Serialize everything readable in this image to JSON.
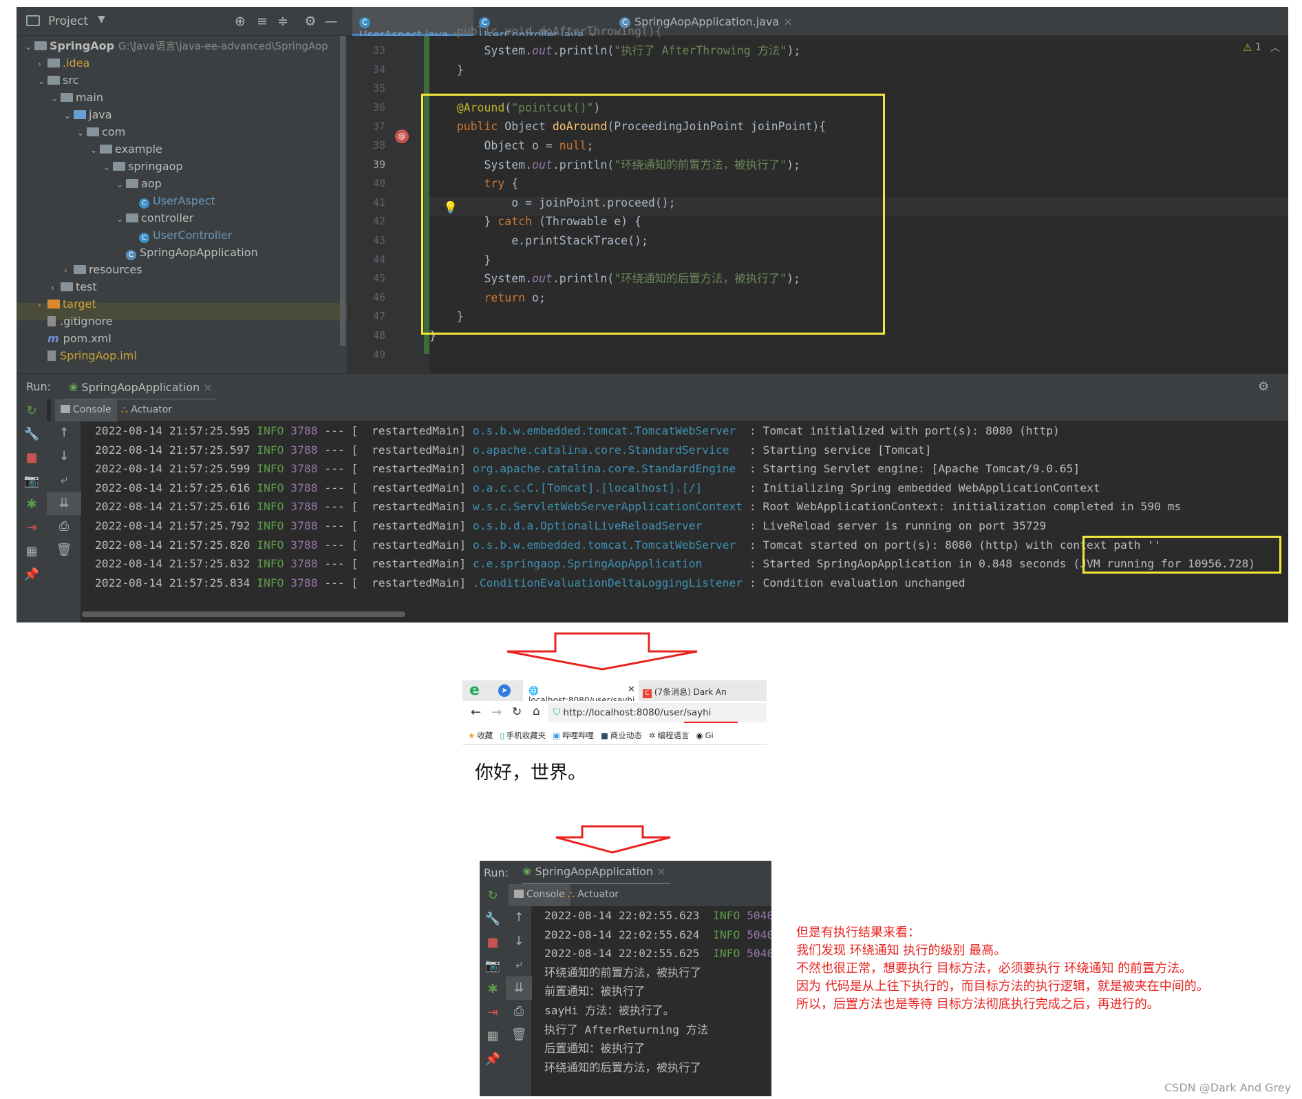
{
  "ide": {
    "project_label": "Project",
    "tabs": [
      {
        "label": "UserAspect.java",
        "active": true
      },
      {
        "label": "UserController.java",
        "active": false
      },
      {
        "label": "SpringAopApplication.java",
        "active": false
      }
    ],
    "warnings_count": "1",
    "tree": [
      {
        "label": "SpringAop",
        "extra": "G:\\Java语言\\java-ee-advanced\\SpringAop",
        "depth": 0,
        "type": "module",
        "open": true
      },
      {
        "label": ".idea",
        "depth": 1,
        "type": "folder",
        "open": false,
        "color": "#c9a338"
      },
      {
        "label": "src",
        "depth": 1,
        "type": "folder",
        "open": true
      },
      {
        "label": "main",
        "depth": 2,
        "type": "folder",
        "open": true
      },
      {
        "label": "java",
        "depth": 3,
        "type": "folder-blue",
        "open": true
      },
      {
        "label": "com",
        "depth": 4,
        "type": "folder",
        "open": true
      },
      {
        "label": "example",
        "depth": 5,
        "type": "folder",
        "open": true
      },
      {
        "label": "springaop",
        "depth": 6,
        "type": "folder",
        "open": true
      },
      {
        "label": "aop",
        "depth": 7,
        "type": "folder",
        "open": true
      },
      {
        "label": "UserAspect",
        "depth": 8,
        "type": "class",
        "color": "#6897bb"
      },
      {
        "label": "controller",
        "depth": 7,
        "type": "folder",
        "open": true
      },
      {
        "label": "UserController",
        "depth": 8,
        "type": "class",
        "color": "#6897bb"
      },
      {
        "label": "SpringAopApplication",
        "depth": 7,
        "type": "app"
      },
      {
        "label": "resources",
        "depth": 3,
        "type": "folder",
        "open": false
      },
      {
        "label": "test",
        "depth": 2,
        "type": "folder",
        "open": false
      },
      {
        "label": "target",
        "depth": 1,
        "type": "folder-orange",
        "open": false,
        "color": "#c9a338"
      },
      {
        "label": ".gitignore",
        "depth": 1,
        "type": "file"
      },
      {
        "label": "pom.xml",
        "depth": 1,
        "type": "maven"
      },
      {
        "label": "SpringAop.iml",
        "depth": 1,
        "type": "file",
        "color": "#c9a338"
      }
    ],
    "line_numbers": [
      "33",
      "34",
      "35",
      "36",
      "37",
      "38",
      "39",
      "40",
      "41",
      "42",
      "43",
      "44",
      "45",
      "46",
      "47",
      "48",
      "49"
    ],
    "code_top_partial": "    public void doAfterThrowing(){",
    "code": [
      [
        {
          "t": "        System."
        },
        {
          "t": "out",
          "c": "fld"
        },
        {
          "t": ".println("
        },
        {
          "t": "\"执行了 AfterThrowing 方法\"",
          "c": "str"
        },
        {
          "t": ");"
        }
      ],
      [
        {
          "t": "    }"
        }
      ],
      [
        {
          "t": ""
        }
      ],
      [
        {
          "t": "    "
        },
        {
          "t": "@Around",
          "c": "ann"
        },
        {
          "t": "("
        },
        {
          "t": "\"pointcut()\"",
          "c": "str"
        },
        {
          "t": ")"
        }
      ],
      [
        {
          "t": "    "
        },
        {
          "t": "public ",
          "c": "kw"
        },
        {
          "t": "Object "
        },
        {
          "t": "doAround",
          "c": "fn"
        },
        {
          "t": "(ProceedingJoinPoint joinPoint){"
        }
      ],
      [
        {
          "t": "        Object o = "
        },
        {
          "t": "null",
          "c": "kw"
        },
        {
          "t": ";"
        }
      ],
      [
        {
          "t": "        System."
        },
        {
          "t": "out",
          "c": "fld"
        },
        {
          "t": ".println("
        },
        {
          "t": "\"环绕通知的前置方法，被执行了\"",
          "c": "str"
        },
        {
          "t": ");"
        }
      ],
      [
        {
          "t": "        "
        },
        {
          "t": "try ",
          "c": "kw"
        },
        {
          "t": "{"
        }
      ],
      [
        {
          "t": "            o = joinPoint.proceed();"
        }
      ],
      [
        {
          "t": "        } "
        },
        {
          "t": "catch ",
          "c": "kw"
        },
        {
          "t": "(Throwable e) {"
        }
      ],
      [
        {
          "t": "            e.printStackTrace();"
        }
      ],
      [
        {
          "t": "        }"
        }
      ],
      [
        {
          "t": "        System."
        },
        {
          "t": "out",
          "c": "fld"
        },
        {
          "t": ".println("
        },
        {
          "t": "\"环绕通知的后置方法，被执行了\"",
          "c": "str"
        },
        {
          "t": ");"
        }
      ],
      [
        {
          "t": "        "
        },
        {
          "t": "return ",
          "c": "kw"
        },
        {
          "t": "o;"
        }
      ],
      [
        {
          "t": "    }"
        }
      ],
      [
        {
          "t": "}"
        }
      ],
      [
        {
          "t": ""
        }
      ]
    ]
  },
  "run": {
    "label": "Run:",
    "config": "SpringAopApplication",
    "console_tab": "Console",
    "actuator_tab": "Actuator",
    "log": [
      {
        "ts": "2022-08-14 21:57:25.595",
        "lvl": "INFO",
        "pid": "3788",
        "sep": "--- [",
        "thread": " restartedMain]",
        "cat": "o.s.b.w.embedded.tomcat.TomcatWebServer  ",
        "msg": ": Tomcat initialized with port(s): 8080 (http)"
      },
      {
        "ts": "2022-08-14 21:57:25.597",
        "lvl": "INFO",
        "pid": "3788",
        "sep": "--- [",
        "thread": " restartedMain]",
        "cat": "o.apache.catalina.core.StandardService   ",
        "msg": ": Starting service [Tomcat]"
      },
      {
        "ts": "2022-08-14 21:57:25.599",
        "lvl": "INFO",
        "pid": "3788",
        "sep": "--- [",
        "thread": " restartedMain]",
        "cat": "org.apache.catalina.core.StandardEngine  ",
        "msg": ": Starting Servlet engine: [Apache Tomcat/9.0.65]"
      },
      {
        "ts": "2022-08-14 21:57:25.616",
        "lvl": "INFO",
        "pid": "3788",
        "sep": "--- [",
        "thread": " restartedMain]",
        "cat": "o.a.c.c.C.[Tomcat].[localhost].[/]       ",
        "msg": ": Initializing Spring embedded WebApplicationContext"
      },
      {
        "ts": "2022-08-14 21:57:25.616",
        "lvl": "INFO",
        "pid": "3788",
        "sep": "--- [",
        "thread": " restartedMain]",
        "cat": "w.s.c.ServletWebServerApplicationContext ",
        "msg": ": Root WebApplicationContext: initialization completed in 590 ms"
      },
      {
        "ts": "2022-08-14 21:57:25.792",
        "lvl": "INFO",
        "pid": "3788",
        "sep": "--- [",
        "thread": " restartedMain]",
        "cat": "o.s.b.d.a.OptionalLiveReloadServer       ",
        "msg": ": LiveReload server is running on port 35729"
      },
      {
        "ts": "2022-08-14 21:57:25.820",
        "lvl": "INFO",
        "pid": "3788",
        "sep": "--- [",
        "thread": " restartedMain]",
        "cat": "o.s.b.w.embedded.tomcat.TomcatWebServer  ",
        "msg": ": Tomcat started on port(s): 8080 (http) with context path ''"
      },
      {
        "ts": "2022-08-14 21:57:25.832",
        "lvl": "INFO",
        "pid": "3788",
        "sep": "--- [",
        "thread": " restartedMain]",
        "cat": "c.e.springaop.SpringAopApplication       ",
        "msg": ": Started SpringAopApplication in 0.848 seconds (JVM running for 10956.728)"
      },
      {
        "ts": "2022-08-14 21:57:25.834",
        "lvl": "INFO",
        "pid": "3788",
        "sep": "--- [",
        "thread": " restartedMain]",
        "cat": ".ConditionEvaluationDeltaLoggingListener ",
        "msg": ": Condition evaluation unchanged"
      }
    ]
  },
  "browser": {
    "tab1": "localhost:8080/user/sayhi",
    "tab2": "(7条消息) Dark An",
    "url": "http://localhost:8080/user/sayhi",
    "bookmarks": [
      "收藏",
      "手机收藏夹",
      "哔哩哔哩",
      "商业动态",
      "编程语言",
      "Gi"
    ],
    "content": "你好，世界。"
  },
  "run2": {
    "label": "Run:",
    "config": "SpringAopApplication",
    "console_tab": "Console",
    "actuator_tab": "Actuator",
    "log": [
      {
        "ts": "2022-08-14 22:02:55.623",
        "lvl": "INFO",
        "pid": "5040"
      },
      {
        "ts": "2022-08-14 22:02:55.624",
        "lvl": "INFO",
        "pid": "5040"
      },
      {
        "ts": "2022-08-14 22:02:55.625",
        "lvl": "INFO",
        "pid": "5040"
      }
    ],
    "output": [
      "环绕通知的前置方法，被执行了",
      "前置通知：被执行了",
      "sayHi 方法：被执行了。",
      "执行了 AfterReturning 方法",
      "后置通知：被执行了",
      "环绕通知的后置方法，被执行了"
    ]
  },
  "note": [
    "但是有执行结果来看：",
    "我们发现 环绕通知 执行的级别 最高。",
    "不然也很正常，想要执行 目标方法，必须要执行 环绕通知 的前置方法。",
    "因为 代码是从上往下执行的，而目标方法的执行逻辑，就是被夹在中间的。",
    "所以，后置方法也是等待 目标方法彻底执行完成之后，再进行的。"
  ],
  "watermark": "CSDN @Dark And Grey",
  "colors": {
    "highlight": "#f5e63a",
    "arrow": "#e8231f",
    "note": "#e8231f"
  }
}
